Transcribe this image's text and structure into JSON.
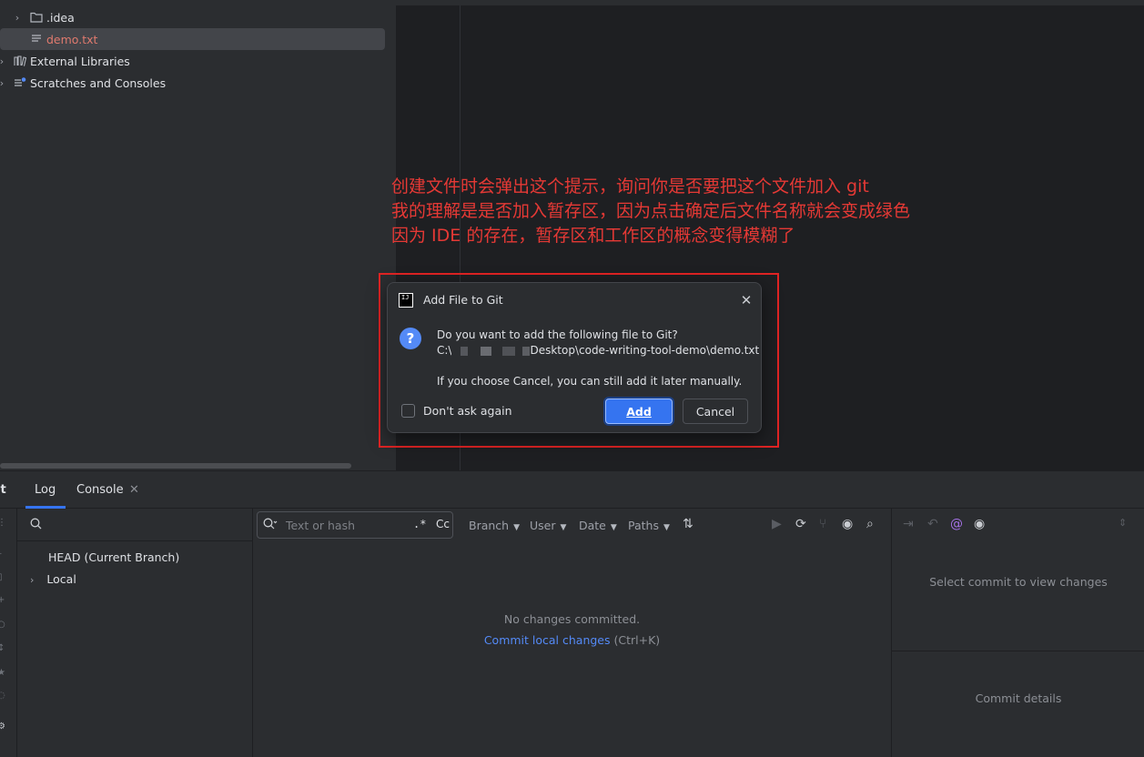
{
  "project_tree": {
    "items": [
      {
        "label": ".idea",
        "icon": "folder-icon"
      },
      {
        "label": "demo.txt",
        "icon": "text-file-icon"
      },
      {
        "label": "External Libraries",
        "icon": "library-icon"
      },
      {
        "label": "Scratches and Consoles",
        "icon": "scratches-icon"
      }
    ]
  },
  "annotation": {
    "lines": [
      "创建文件时会弹出这个提示，询问你是否要把这个文件加入 git",
      "我的理解是是否加入暂存区，因为点击确定后文件名称就会变成绿色",
      "因为 IDE 的存在，暂存区和工作区的概念变得模糊了"
    ],
    "color": "#e53935"
  },
  "dialog": {
    "logo_text": "IJ",
    "title": "Add File to Git",
    "message": "Do you want to add the following file to Git?",
    "path_prefix": "C:\\",
    "path_suffix": "Desktop\\code-writing-tool-demo\\demo.txt",
    "hint": "If you choose Cancel, you can still add it later manually.",
    "dont_ask_label": "Don't ask again",
    "add_label": "Add",
    "cancel_label": "Cancel",
    "accent": "#3574f0"
  },
  "bottom": {
    "tab_git": "it",
    "tab_log": "Log",
    "tab_console": "Console",
    "branches": {
      "head": "HEAD (Current Branch)",
      "local": "Local"
    },
    "filter": {
      "placeholder": "Text or hash",
      "regex_label": ".*",
      "case_label": "Cc",
      "branch": "Branch",
      "user": "User",
      "date": "Date",
      "paths": "Paths"
    },
    "log_empty": "No changes committed.",
    "log_commit_link": "Commit local changes",
    "log_commit_shortcut": "(Ctrl+K)",
    "changes_empty": "Select commit to view changes",
    "details_empty": "Commit details"
  }
}
